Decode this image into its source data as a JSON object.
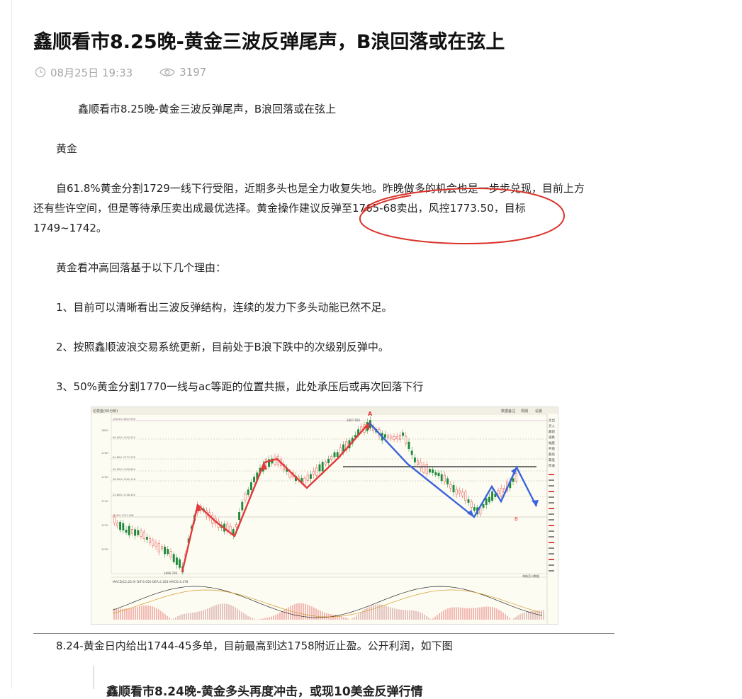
{
  "article": {
    "title": "鑫顺看市8.25晚-黄金三波反弹尾声，B浪回落或在弦上",
    "time": "08月25日 19:33",
    "views": "3197",
    "paragraphs": {
      "subtitle": "鑫顺看市8.25晚-黄金三波反弹尾声，B浪回落或在弦上",
      "section": "黄金",
      "para1_line1": "自61.8%黄金分割1729一线下行受阻，近期多头也是全力收复失地。昨晚做多的机会也是一步步兑现，目前上方",
      "para1_line2": "还有些许空间，但是等待承压卖出成最优选择。黄金操作建议反弹至1765-68卖出，风控1773.50，目标",
      "para1_line3": "1749~1742。",
      "reasons_intro": "黄金看冲高回落基于以下几个理由：",
      "reason1": "1、目前可以清晰看出三波反弹结构，连续的发力下多头动能已然不足。",
      "reason2": "2、按照鑫顺波浪交易系统更新，目前处于B浪下跌中的次级别反弹中。",
      "reason3": "3、50%黄金分割1770一线与ac等距的位置共振，此处承压后或再次回落下行",
      "after_chart": "8.24-黄金日内给出1744-45多单，目前最高到达1758附近止盈。公开利润，如下图",
      "next_article_cut": "鑫顺看市8.24晚-黄金多头再度冲击，或现10美金反弹行情"
    }
  },
  "chart": {
    "label_a": "A",
    "label_b": "B",
    "header_left": "伦敦金(60分钟)",
    "header_right_1": "数据备注",
    "header_right_2": "周期",
    "header_right_3": "设置",
    "fib_labels": [
      "100.0% 1807.950",
      "90.00% 1792.022",
      "61.80% 1777.132",
      "50.00% 1769.694",
      "38.20% 1762.126",
      "23.60% 1746.302",
      "0.00% 1721.008"
    ],
    "price_labels": [
      "1800",
      "1780",
      "1760",
      "1740",
      "1720",
      "1700"
    ],
    "low_label": "1690.700",
    "high_label": "1807.950",
    "macd_label": "MACD(12,26,9)  DIF:6.050  DEA:2.283  MACD:4.478",
    "side_labels": [
      "卖出",
      "买入",
      "最新",
      "涨跌",
      "幅度",
      "开盘",
      "最高",
      "最低",
      "昨收"
    ],
    "bottom_right": "海纳百川数据",
    "colors": {
      "red_arrow": "#e03a3a",
      "blue_arrow": "#3a64d8",
      "circle": "#d9342b",
      "up_candle": "#e24a4a",
      "down_candle": "#1f8a3a"
    }
  }
}
